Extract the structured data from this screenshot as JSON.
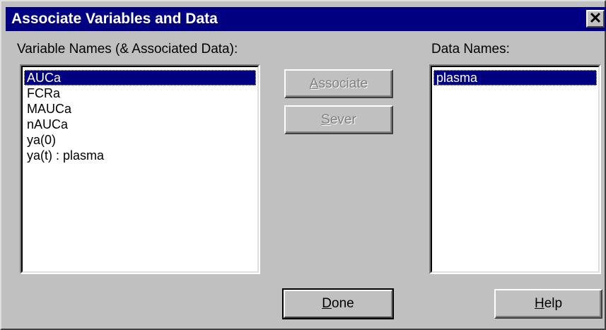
{
  "window": {
    "title": "Associate Variables and Data",
    "close_glyph": "✕"
  },
  "variables": {
    "label": "Variable Names (& Associated Data):",
    "items": [
      "AUCa",
      "FCRa",
      "MAUCa",
      "nAUCa",
      "ya(0)",
      "ya(t) : plasma"
    ],
    "selected_index": 0
  },
  "data_names": {
    "label": "Data Names:",
    "items": [
      "plasma"
    ],
    "selected_index": 0
  },
  "buttons": {
    "associate": {
      "mnemonic": "A",
      "rest": "ssociate",
      "enabled": false
    },
    "sever": {
      "mnemonic": "S",
      "rest": "ever",
      "enabled": false
    },
    "done": {
      "mnemonic": "D",
      "rest": "one",
      "enabled": true
    },
    "help": {
      "mnemonic": "H",
      "rest": "elp",
      "enabled": true
    }
  },
  "colors": {
    "titlebar": "#000080",
    "face": "#c0c0c0",
    "selection": "#000080"
  }
}
